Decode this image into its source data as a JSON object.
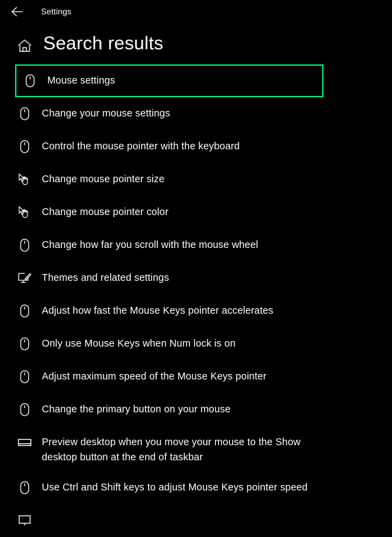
{
  "titlebar": {
    "back_label": "back-arrow",
    "app_title": "Settings"
  },
  "header": {
    "home_icon": "home-icon",
    "title": "Search results"
  },
  "colors": {
    "background": "#000000",
    "text": "#ffffff",
    "selection_highlight": "#00e27a"
  },
  "results": {
    "items": [
      {
        "label": "Mouse settings",
        "icon": "mouse-icon",
        "selected": true
      },
      {
        "label": "Change your mouse settings",
        "icon": "mouse-icon",
        "selected": false
      },
      {
        "label": "Control the mouse pointer with the keyboard",
        "icon": "mouse-icon",
        "selected": false
      },
      {
        "label": "Change mouse pointer size",
        "icon": "hand-pointer-icon",
        "selected": false
      },
      {
        "label": "Change mouse pointer color",
        "icon": "hand-pointer-icon",
        "selected": false
      },
      {
        "label": "Change how far you scroll with the mouse wheel",
        "icon": "mouse-icon",
        "selected": false
      },
      {
        "label": "Themes and related settings",
        "icon": "themes-monitor-brush-icon",
        "selected": false
      },
      {
        "label": "Adjust how fast the Mouse Keys pointer accelerates",
        "icon": "mouse-icon",
        "selected": false
      },
      {
        "label": "Only use Mouse Keys when Num lock is on",
        "icon": "mouse-icon",
        "selected": false
      },
      {
        "label": "Adjust maximum speed of the Mouse Keys pointer",
        "icon": "mouse-icon",
        "selected": false
      },
      {
        "label": "Change the primary button on your mouse",
        "icon": "mouse-icon",
        "selected": false
      },
      {
        "label": "Preview desktop when you move your mouse to the Show\ndesktop button at the end of taskbar",
        "icon": "taskbar-icon",
        "selected": false
      },
      {
        "label": "Use Ctrl and Shift keys to adjust Mouse Keys pointer speed",
        "icon": "mouse-icon",
        "selected": false
      },
      {
        "label": "",
        "icon": "monitor-icon",
        "selected": false
      }
    ]
  }
}
